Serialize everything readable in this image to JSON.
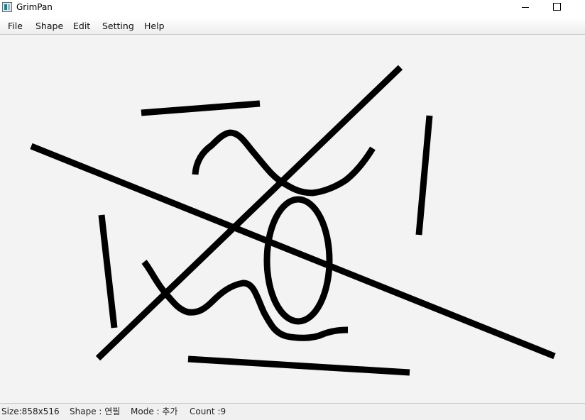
{
  "window": {
    "title": "GrimPan"
  },
  "menu": {
    "file": "File",
    "shape": "Shape",
    "edit": "Edit",
    "setting": "Setting",
    "help": "Help"
  },
  "canvas": {
    "background": "#f3f3f3",
    "stroke_color": "#000000",
    "shape_count": 9
  },
  "status": {
    "size": "Size:858x516",
    "shape": "Shape : 연필",
    "mode": "Mode : 추가",
    "count": "Count :9"
  },
  "icons": {
    "app": "grimpan-app-icon",
    "minimize": "minimize-icon",
    "maximize": "maximize-icon"
  }
}
